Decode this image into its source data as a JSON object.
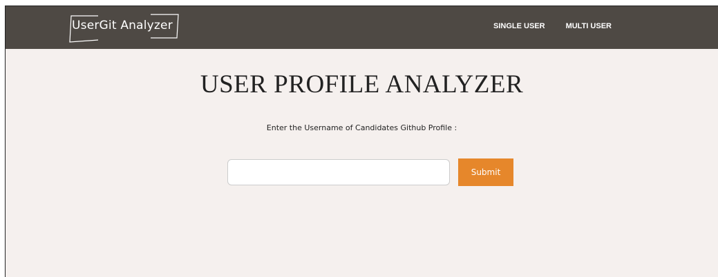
{
  "navbar": {
    "logo_text": "UserGit Analyzer",
    "links": [
      {
        "label": "SINGLE USER"
      },
      {
        "label": "MULTI USER"
      }
    ],
    "background": "#4e4944"
  },
  "main": {
    "title": "USER PROFILE ANALYZER",
    "prompt": "Enter the Username of Candidates Github Profile :",
    "input": {
      "value": "",
      "placeholder": ""
    },
    "submit_label": "Submit",
    "accent": "#e6872b",
    "background": "#f5f0ee"
  }
}
